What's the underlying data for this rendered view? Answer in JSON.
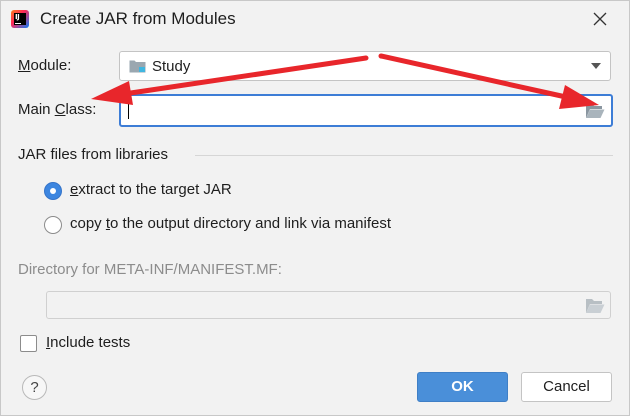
{
  "window": {
    "title": "Create JAR from Modules"
  },
  "form": {
    "module_label_u": "M",
    "module_label_rest": "odule:",
    "module_value": "Study",
    "main_class_label_pre": "Main ",
    "main_class_label_u": "C",
    "main_class_label_rest": "lass:",
    "main_class_value": ""
  },
  "libraries": {
    "section_title": "JAR files from libraries",
    "options": [
      {
        "u": "e",
        "rest": "xtract to the target JAR",
        "selected": true
      },
      {
        "pre": "copy ",
        "u": "t",
        "rest": "o the output directory and link via manifest",
        "selected": false
      }
    ]
  },
  "manifest": {
    "label": "Directory for META-INF/MANIFEST.MF:",
    "value": ""
  },
  "include_tests": {
    "u": "I",
    "rest": "nclude tests",
    "checked": false
  },
  "footer": {
    "help_label": "?",
    "ok_label": "OK",
    "cancel_label": "Cancel"
  },
  "colors": {
    "accent": "#3d7dd6",
    "ok_button": "#4a8fd9",
    "annotation_arrow": "#e8262b"
  },
  "icons": {
    "app": "intellij-idea-icon",
    "close": "close-icon",
    "module": "module-folder-icon",
    "dropdown": "chevron-down-icon",
    "browse": "folder-open-icon"
  }
}
